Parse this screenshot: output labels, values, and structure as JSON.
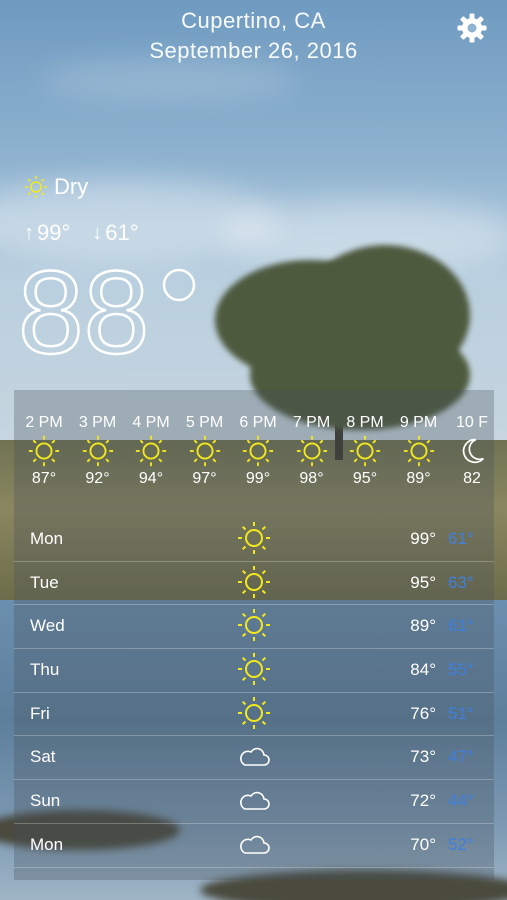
{
  "header": {
    "city": "Cupertino, CA",
    "date": "September 26, 2016"
  },
  "current": {
    "condition": "Dry",
    "condition_icon": "sun-icon",
    "high": "99°",
    "low": "61°",
    "temp_number": "88",
    "temp_degree": "°"
  },
  "hourly": [
    {
      "time": "2 PM",
      "icon": "sun-icon",
      "temp": "87°"
    },
    {
      "time": "3 PM",
      "icon": "sun-icon",
      "temp": "92°"
    },
    {
      "time": "4 PM",
      "icon": "sun-icon",
      "temp": "94°"
    },
    {
      "time": "5 PM",
      "icon": "sun-icon",
      "temp": "97°"
    },
    {
      "time": "6 PM",
      "icon": "sun-icon",
      "temp": "99°"
    },
    {
      "time": "7 PM",
      "icon": "sun-icon",
      "temp": "98°"
    },
    {
      "time": "8 PM",
      "icon": "sun-icon",
      "temp": "95°"
    },
    {
      "time": "9 PM",
      "icon": "sun-icon",
      "temp": "89°"
    },
    {
      "time": "10 F",
      "icon": "moon-icon",
      "temp": "82"
    }
  ],
  "daily": [
    {
      "day": "Mon",
      "icon": "sun-icon",
      "hi": "99°",
      "lo": "61°"
    },
    {
      "day": "Tue",
      "icon": "sun-icon",
      "hi": "95°",
      "lo": "63°"
    },
    {
      "day": "Wed",
      "icon": "sun-icon",
      "hi": "89°",
      "lo": "61°"
    },
    {
      "day": "Thu",
      "icon": "sun-icon",
      "hi": "84°",
      "lo": "55°"
    },
    {
      "day": "Fri",
      "icon": "sun-icon",
      "hi": "76°",
      "lo": "51°"
    },
    {
      "day": "Sat",
      "icon": "cloud-icon",
      "hi": "73°",
      "lo": "47°"
    },
    {
      "day": "Sun",
      "icon": "cloud-icon",
      "hi": "72°",
      "lo": "44°"
    },
    {
      "day": "Mon",
      "icon": "cloud-icon",
      "hi": "70°",
      "lo": "52°"
    }
  ],
  "colors": {
    "sun": "#f2e81c",
    "low_temp": "#3f7fe0"
  }
}
